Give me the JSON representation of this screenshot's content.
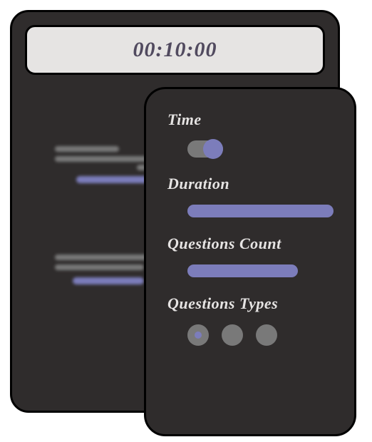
{
  "timer": {
    "display": "00:10:00"
  },
  "settings": {
    "time": {
      "label": "Time",
      "enabled": true
    },
    "duration": {
      "label": "Duration"
    },
    "questions_count": {
      "label": "Questions Count"
    },
    "questions_types": {
      "label": "Questions Types",
      "options": [
        {
          "selected": true
        },
        {
          "selected": false
        },
        {
          "selected": false
        }
      ]
    }
  }
}
